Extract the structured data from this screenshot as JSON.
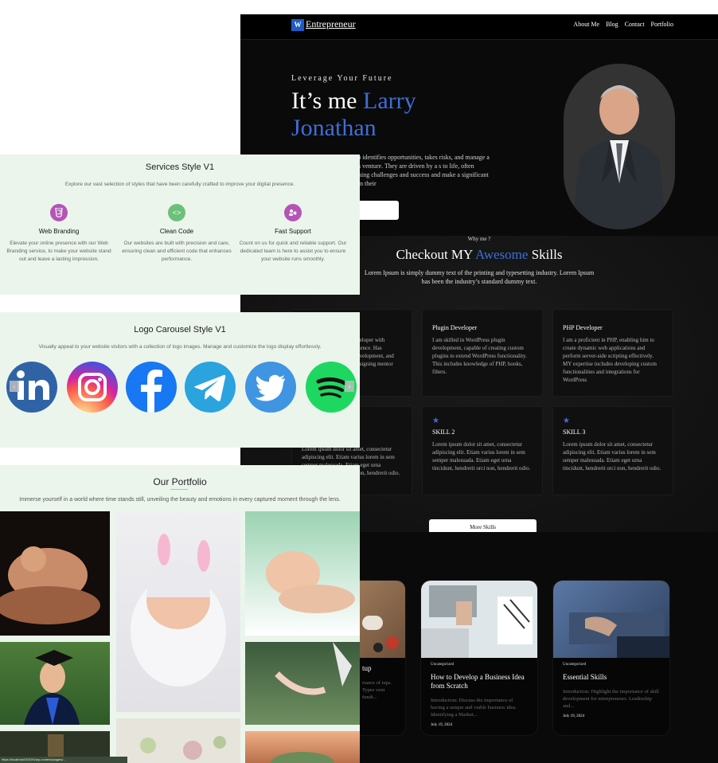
{
  "dark_site": {
    "logo_letters": "W",
    "logo_text": "Entrepreneur",
    "nav": [
      "About Me",
      "Blog",
      "Contact",
      "Portfolio"
    ],
    "hero": {
      "kicker": "Leverage Your Future",
      "title_prefix": "It’s me ",
      "title_name": "Larry Jonathan",
      "body": "one who identifies opportunities, takes risks, and manage a business venture. They are driven by a s to life, often overcoming challenges and success and make a significant impact in their"
    },
    "skills": {
      "kicker": "Why me ?",
      "heading_a": "Checkout MY ",
      "heading_b": "Awesome",
      "heading_c": " Skills",
      "intro": "Lorem Ipsum is simply dummy text of the printing and typesetting industry. Lorem Ipsum has been the industry’s standard dummy text.",
      "cards": [
        {
          "title": "r",
          "text": "eveloper with erience. Has development, and designing mentor"
        },
        {
          "title": "Plugin Developer",
          "text": "I am skilled in WordPress plugin development, capable of creating custom plugins to extend WordPress functionality. This includes knowledge of PHP, hooks, filters."
        },
        {
          "title": "PHP Developer",
          "text": "I am a proficient in PHP, enabling him to create dynamic web applications and perform server-side scripting effectively. MY expertise includes developing custom functionalities and integrations for WordPress"
        },
        {
          "title": "",
          "text": "Lorem ipsum dolor sit amet, consectetur adipiscing elit. Etiam varius lorem in sem semper malesuada. Etiam eget urna tincidunt, hendrerit orci non, hendrerit odio."
        },
        {
          "title": "SKILL 2",
          "text": "Lorem ipsum dolor sit amet, consectetur adipiscing elit. Etiam varius lorem in sem semper malesuada. Etiam eget urna tincidunt, hendrerit orci non, hendrerit odio."
        },
        {
          "title": "SKILL 3",
          "text": "Lorem ipsum dolor sit amet, consectetur adipiscing elit. Etiam varius lorem in sem semper malesuada. Etiam eget urna tincidunt, hendrerit orci non, hendrerit odio."
        }
      ],
      "more_button": "More Skills"
    },
    "blog": [
      {
        "category": "",
        "title": "tup",
        "excerpt": "rtance of tups. Types vent fundi...",
        "date": ""
      },
      {
        "category": "Uncategorized",
        "title": "How to Develop a Business Idea from Scratch",
        "excerpt": "Introduction: Discuss the importance of having a unique and viable business idea. Identifying a Market...",
        "date": "July 19, 2024"
      },
      {
        "category": "Uncategorized",
        "title": "Essential Skills",
        "excerpt": "Introduction: Highlight the importance of skill development for entrepreneurs. Leadership and...",
        "date": "July 19, 2024"
      }
    ]
  },
  "services": {
    "title": "Services Style V1",
    "subtitle": "Explore our vast selection of styles that have been carefully crafted to improve your digital presence.",
    "items": [
      {
        "title": "Web Branding",
        "icon": "css-icon",
        "color": "#b455b6",
        "text": "Elevate your online presence with our Web Branding service, to make your website stand out and leave a lasting impression."
      },
      {
        "title": "Clean Code",
        "icon": "code-icon",
        "color": "#6cc07a",
        "text": "Our websites are built with precision and care, ensuring clean and efficient code that enhances performance."
      },
      {
        "title": "Fast Support",
        "icon": "support-icon",
        "color": "#b455b6",
        "text": "Count on us for quick and reliable support. Our dedicated team is here to assist you to ensure your website runs smoothly."
      }
    ]
  },
  "logo_carousel": {
    "title": "Logo Carousel Style V1",
    "subtitle": "Visually appeal to your website visitors with a collection of logo images. Manage and customize the logo display effortlessly.",
    "logos": [
      "linkedin-logo",
      "instagram-logo",
      "facebook-logo",
      "telegram-logo",
      "twitter-logo",
      "spotify-logo"
    ],
    "prev_label": "‹",
    "next_label": "›"
  },
  "portfolio": {
    "title": "Our Portfolio",
    "subtitle": "Immerse yourself in a world where time stands still, unveiling the beauty and emotions in every captured moment through the lens."
  },
  "status_text": "https://localhost/OOOKl/wp-content/plugins/..."
}
